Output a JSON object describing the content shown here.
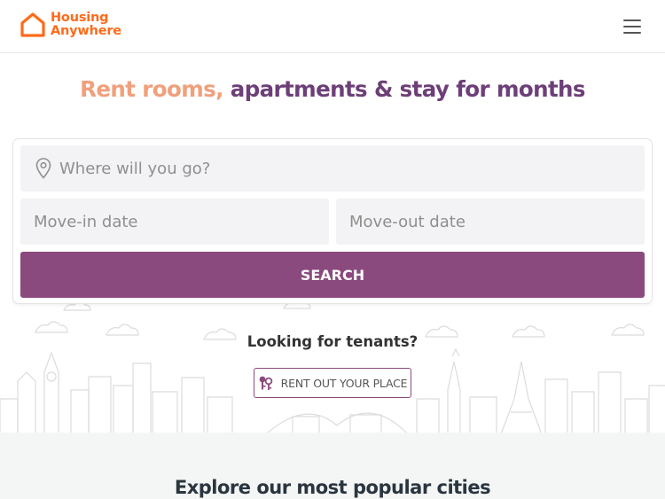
{
  "brand": {
    "line1": "Housing",
    "line2": "Anywhere",
    "color": "#ff6b1a"
  },
  "header": {
    "menu_icon": "hamburger-menu-icon"
  },
  "hero": {
    "headline_accent": "Rent rooms,",
    "headline_rest": " apartments & stay for months",
    "search": {
      "where_placeholder": "Where will you go?",
      "movein_placeholder": "Move-in date",
      "moveout_placeholder": "Move-out date",
      "button_label": "SEARCH",
      "button_color": "#8b4a7e"
    },
    "tenants_title": "Looking for tenants?",
    "rent_button_label": "RENT OUT YOUR PLACE",
    "rent_icon": "keys-icon"
  },
  "popular": {
    "title": "Explore our most popular cities"
  }
}
